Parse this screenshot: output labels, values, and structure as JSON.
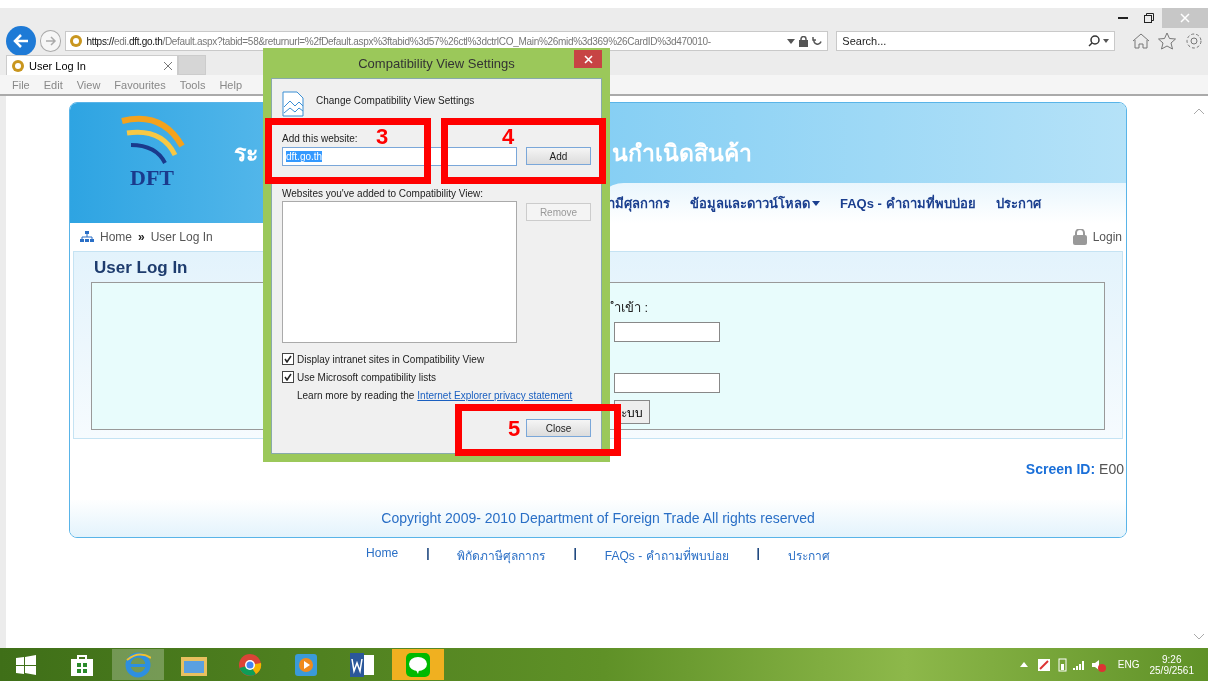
{
  "browser": {
    "address": {
      "scheme": "https://",
      "host_pre": "edi.",
      "host": "dft.go.th",
      "path": "/Default.aspx?tabid=58&returnurl=%2fDefault.aspx%3ftabid%3d57%26ctl%3dctrlCO_Main%26mid%3d369%26CardID%3d470010-"
    },
    "search": {
      "placeholder": "Search..."
    },
    "tabs": [
      {
        "label": "User Log In",
        "selected": true
      }
    ],
    "menu": [
      "File",
      "Edit",
      "View",
      "Favourites",
      "Tools",
      "Help"
    ]
  },
  "page": {
    "logo_text": "DFT",
    "title_left": "ระ",
    "title_right": "นกำเนิดสินค้า",
    "nav": [
      {
        "label": "ามีศุลกากร",
        "dropdown": false
      },
      {
        "label": "ข้อมูลและดาวน์โหลด",
        "dropdown": true
      },
      {
        "label": "FAQs - คำถามที่พบบ่อย",
        "dropdown": false
      },
      {
        "label": "ประกาศ",
        "dropdown": false
      }
    ],
    "breadcrumb": [
      "Home",
      "User Log In"
    ],
    "breadcrumb_separator": "»",
    "login": "Login",
    "panel_title": "User Log In",
    "form": {
      "label": "ำเข้า :",
      "button": "ะบบ"
    },
    "screen_id": {
      "label": "Screen ID:",
      "value": "E00"
    },
    "copyright": "Copyright 2009- 2010 Department of Foreign Trade All rights reserved",
    "footer": [
      {
        "kind": "link",
        "text": "Home"
      },
      {
        "kind": "separator",
        "text": "|"
      },
      {
        "kind": "link",
        "text": "พิกัดภาษีศุลกากร"
      },
      {
        "kind": "separator",
        "text": "|"
      },
      {
        "kind": "link",
        "text": "FAQs - คำถามที่พบบ่อย"
      },
      {
        "kind": "separator",
        "text": "|"
      },
      {
        "kind": "link",
        "text": "ประกาศ"
      }
    ]
  },
  "dialog": {
    "title": "Compatibility View Settings",
    "heading": "Change Compatibility View Settings",
    "add_label": "Add this website:",
    "add_value": "dft.go.th",
    "add_button": {
      "label": "Add",
      "disabled": false
    },
    "list_label": "Websites you've added to Compatibility View:",
    "remove_button": {
      "label": "Remove",
      "disabled": true
    },
    "options": [
      {
        "label": "Display intranet sites in Compatibility View",
        "checked": true
      },
      {
        "label": "Use Microsoft compatibility lists",
        "checked": true
      }
    ],
    "learn_more": "Learn more by reading the",
    "learn_link": "Internet Explorer privacy statement",
    "close_button": "Close"
  },
  "annotations": [
    {
      "label": "3"
    },
    {
      "label": "4"
    },
    {
      "label": "5"
    }
  ],
  "tray": {
    "language": "ENG",
    "time": "9:26",
    "date": "25/9/2561"
  }
}
